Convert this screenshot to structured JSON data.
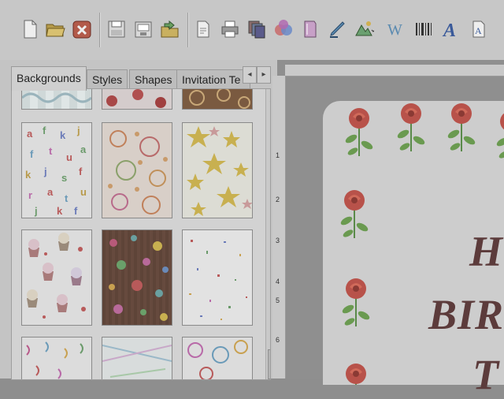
{
  "toolbar": {
    "buttons": [
      {
        "name": "new-document-icon"
      },
      {
        "name": "open-folder-icon"
      },
      {
        "name": "close-icon"
      },
      {
        "name": "save-icon"
      },
      {
        "name": "save-as-icon"
      },
      {
        "name": "export-folder-icon"
      },
      {
        "name": "page-setup-icon"
      },
      {
        "name": "print-icon"
      },
      {
        "name": "copies-icon"
      },
      {
        "name": "color-circles-icon"
      },
      {
        "name": "background-tool-icon"
      },
      {
        "name": "pen-icon"
      },
      {
        "name": "image-icon"
      },
      {
        "name": "wordart-icon"
      },
      {
        "name": "barcode-icon"
      },
      {
        "name": "text-icon"
      },
      {
        "name": "text-box-icon"
      }
    ]
  },
  "tabs": [
    {
      "label": "Backgrounds",
      "active": true
    },
    {
      "label": "Styles"
    },
    {
      "label": "Shapes"
    },
    {
      "label": "Invitation Te"
    }
  ],
  "tab_nav": {
    "prev": "◂",
    "next": "▸"
  },
  "gallery": {
    "scroll_up": "▲",
    "thumbnails": [
      {
        "name": "background-thumb-wave"
      },
      {
        "name": "background-thumb-roses-red"
      },
      {
        "name": "background-thumb-brown-swirl"
      },
      {
        "name": "background-thumb-letters"
      },
      {
        "name": "background-thumb-paisley"
      },
      {
        "name": "background-thumb-stars"
      },
      {
        "name": "background-thumb-cupcakes"
      },
      {
        "name": "background-thumb-brown-dots"
      },
      {
        "name": "background-thumb-confetti"
      },
      {
        "name": "background-thumb-streamers"
      },
      {
        "name": "background-thumb-pastel-lines"
      },
      {
        "name": "background-thumb-balloons"
      }
    ]
  },
  "ruler": {
    "left_numbers": [
      "1",
      "2",
      "3",
      "4",
      "5",
      "6"
    ]
  },
  "card": {
    "line1": "H",
    "line2": "BIR",
    "line3": "T"
  }
}
